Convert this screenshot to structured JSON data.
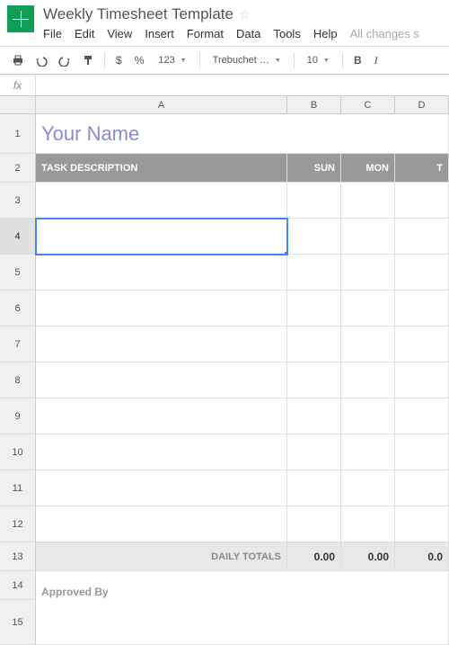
{
  "doc": {
    "title": "Weekly Timesheet Template"
  },
  "menu": {
    "file": "File",
    "edit": "Edit",
    "view": "View",
    "insert": "Insert",
    "format": "Format",
    "data": "Data",
    "tools": "Tools",
    "help": "Help",
    "status": "All changes s"
  },
  "toolbar": {
    "dollar": "$",
    "percent": "%",
    "num": "123",
    "font": "Trebuchet …",
    "size": "10",
    "bold": "B",
    "italic": "I"
  },
  "fx": {
    "label": "fx"
  },
  "cols": {
    "A": "A",
    "B": "B",
    "C": "C",
    "D": "D"
  },
  "rows": {
    "r1": "1",
    "r2": "2",
    "r3": "3",
    "r4": "4",
    "r5": "5",
    "r6": "6",
    "r7": "7",
    "r8": "8",
    "r9": "9",
    "r10": "10",
    "r11": "11",
    "r12": "12",
    "r13": "13",
    "r14": "14",
    "r15": "15"
  },
  "sheet": {
    "name": "Your Name",
    "task_header": "TASK DESCRIPTION",
    "sun": "SUN",
    "mon": "MON",
    "tue": "T",
    "totals_label": "DAILY TOTALS",
    "total_b": "0.00",
    "total_c": "0.00",
    "total_d": "0.0",
    "approved": "Approved By"
  }
}
